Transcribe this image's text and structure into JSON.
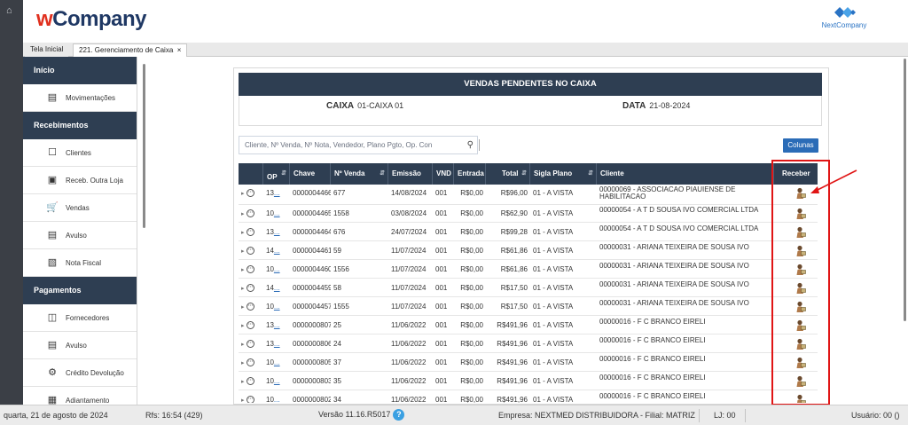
{
  "app": {
    "logo_w": "w",
    "logo_rest": "Company",
    "brand_name": "NextCompany",
    "home_icon": "home-icon"
  },
  "tabs": [
    {
      "label": "Tela Inicial"
    },
    {
      "label": "221. Gerenciamento de Caixa",
      "close": "×"
    }
  ],
  "sidebar": {
    "sections": [
      {
        "title": "Início",
        "items": [
          {
            "label": "Movimentações",
            "icon": "cash-register-icon"
          }
        ]
      },
      {
        "title": "Recebimentos",
        "items": [
          {
            "label": "Clientes",
            "icon": "handshake-icon"
          },
          {
            "label": "Receb. Outra Loja",
            "icon": "card-icon"
          },
          {
            "label": "Vendas",
            "icon": "cart-icon"
          },
          {
            "label": "Avulso",
            "icon": "document-icon"
          },
          {
            "label": "Nota Fiscal",
            "icon": "invoice-icon"
          }
        ]
      },
      {
        "title": "Pagamentos",
        "items": [
          {
            "label": "Fornecedores",
            "icon": "supplier-icon"
          },
          {
            "label": "Avulso",
            "icon": "document-icon"
          },
          {
            "label": "Crédito Devolução",
            "icon": "credit-icon"
          },
          {
            "label": "Adiantamento",
            "icon": "advance-icon"
          }
        ]
      }
    ]
  },
  "panel": {
    "title": "VENDAS PENDENTES NO CAIXA",
    "caixa_label": "CAIXA",
    "caixa_value": "01-CAIXA 01",
    "data_label": "DATA",
    "data_value": "21-08-2024",
    "search_placeholder": "Cliente, Nº Venda, Nº Nota, Vendedor, Plano Pgto, Op. Con",
    "colunas_label": "Colunas"
  },
  "table": {
    "headers": [
      "OP",
      "Chave",
      "Nº Venda",
      "Emissão",
      "VND",
      "Entrada",
      "Total",
      "Sigla Plano",
      "Cliente",
      "Receber"
    ],
    "rows": [
      {
        "op": "13",
        "chave": "0000004466",
        "venda": "677",
        "emissao": "14/08/2024",
        "vnd": "001",
        "entrada": "R$0,00",
        "total": "R$96,00",
        "plano": "01 - A VISTA",
        "cliente": "00000069 - ASSOCIACAO PIAUIENSE DE HABILITACAO"
      },
      {
        "op": "10",
        "chave": "0000004465",
        "venda": "1558",
        "emissao": "03/08/2024",
        "vnd": "001",
        "entrada": "R$0,00",
        "total": "R$62,90",
        "plano": "01 - A VISTA",
        "cliente": "00000054 - A T D SOUSA IVO COMERCIAL LTDA"
      },
      {
        "op": "13",
        "chave": "0000004464",
        "venda": "676",
        "emissao": "24/07/2024",
        "vnd": "001",
        "entrada": "R$0,00",
        "total": "R$99,28",
        "plano": "01 - A VISTA",
        "cliente": "00000054 - A T D SOUSA IVO COMERCIAL LTDA"
      },
      {
        "op": "14",
        "chave": "0000004461",
        "venda": "59",
        "emissao": "11/07/2024",
        "vnd": "001",
        "entrada": "R$0,00",
        "total": "R$61,86",
        "plano": "01 - A VISTA",
        "cliente": "00000031 - ARIANA TEIXEIRA DE SOUSA IVO"
      },
      {
        "op": "10",
        "chave": "0000004460",
        "venda": "1556",
        "emissao": "11/07/2024",
        "vnd": "001",
        "entrada": "R$0,00",
        "total": "R$61,86",
        "plano": "01 - A VISTA",
        "cliente": "00000031 - ARIANA TEIXEIRA DE SOUSA IVO"
      },
      {
        "op": "14",
        "chave": "0000004459",
        "venda": "58",
        "emissao": "11/07/2024",
        "vnd": "001",
        "entrada": "R$0,00",
        "total": "R$17,50",
        "plano": "01 - A VISTA",
        "cliente": "00000031 - ARIANA TEIXEIRA DE SOUSA IVO"
      },
      {
        "op": "10",
        "chave": "0000004457",
        "venda": "1555",
        "emissao": "11/07/2024",
        "vnd": "001",
        "entrada": "R$0,00",
        "total": "R$17,50",
        "plano": "01 - A VISTA",
        "cliente": "00000031 - ARIANA TEIXEIRA DE SOUSA IVO"
      },
      {
        "op": "13",
        "chave": "0000000807",
        "venda": "25",
        "emissao": "11/06/2022",
        "vnd": "001",
        "entrada": "R$0,00",
        "total": "R$491,96",
        "plano": "01 - A VISTA",
        "cliente": "00000016 - F C BRANCO EIRELI"
      },
      {
        "op": "13",
        "chave": "0000000806",
        "venda": "24",
        "emissao": "11/06/2022",
        "vnd": "001",
        "entrada": "R$0,00",
        "total": "R$491,96",
        "plano": "01 - A VISTA",
        "cliente": "00000016 - F C BRANCO EIRELI"
      },
      {
        "op": "10",
        "chave": "0000000805",
        "venda": "37",
        "emissao": "11/06/2022",
        "vnd": "001",
        "entrada": "R$0,00",
        "total": "R$491,96",
        "plano": "01 - A VISTA",
        "cliente": "00000016 - F C BRANCO EIRELI"
      },
      {
        "op": "10",
        "chave": "0000000803",
        "venda": "35",
        "emissao": "11/06/2022",
        "vnd": "001",
        "entrada": "R$0,00",
        "total": "R$491,96",
        "plano": "01 - A VISTA",
        "cliente": "00000016 - F C BRANCO EIRELI"
      },
      {
        "op": "10",
        "chave": "0000000802",
        "venda": "34",
        "emissao": "11/06/2022",
        "vnd": "001",
        "entrada": "R$0,00",
        "total": "R$491,96",
        "plano": "01 - A VISTA",
        "cliente": "00000016 - F C BRANCO EIRELI"
      }
    ],
    "op_suffix": "...",
    "receive_icon": "receive-payment-icon"
  },
  "footer": {
    "datetime": "quarta, 21 de agosto de 2024",
    "rfs": "Rfs: 16:54 (429)",
    "version": "Versão 11.16.R5017",
    "help": "?",
    "empresa": "Empresa: NEXTMED DISTRIBUIDORA - Filial: MATRIZ",
    "lj": "LJ: 00",
    "usuario": "Usuário: 00 ()"
  },
  "colors": {
    "header_dark": "#2e3e52",
    "accent_blue": "#2b6cb7",
    "highlight_red": "#e01515",
    "logo_red": "#e0301e",
    "logo_navy": "#1f3864"
  }
}
